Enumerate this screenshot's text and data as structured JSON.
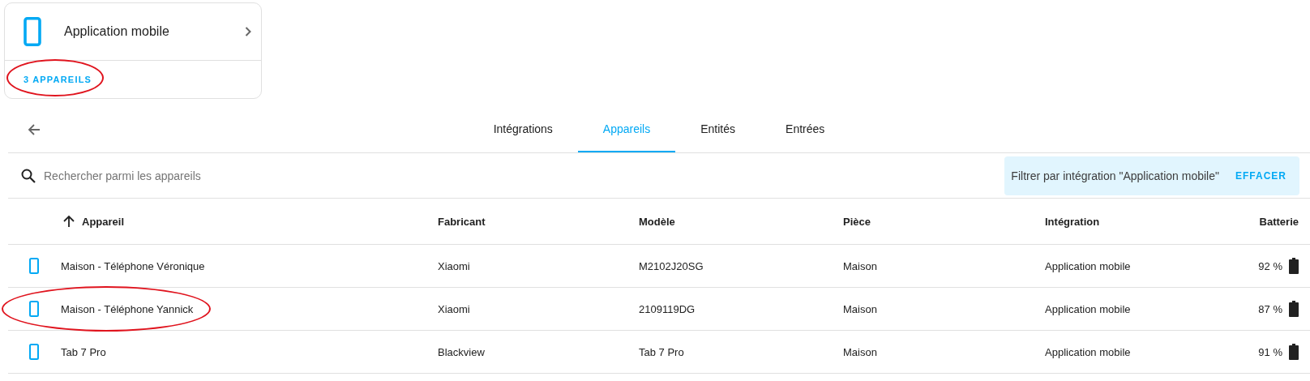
{
  "card": {
    "title": "Application mobile",
    "link": "3 APPAREILS",
    "circled": true
  },
  "tabs": [
    {
      "label": "Intégrations",
      "selected": false
    },
    {
      "label": "Appareils",
      "selected": true
    },
    {
      "label": "Entités",
      "selected": false
    },
    {
      "label": "Entrées",
      "selected": false
    }
  ],
  "search": {
    "placeholder": "Rechercher parmi les appareils"
  },
  "filter": {
    "label": "Filtrer par intégration \"Application mobile\"",
    "action": "EFFACER"
  },
  "table": {
    "columns": [
      {
        "label": "Appareil",
        "sorted": true
      },
      {
        "label": "Fabricant",
        "sorted": false
      },
      {
        "label": "Modèle",
        "sorted": false
      },
      {
        "label": "Pièce",
        "sorted": false
      },
      {
        "label": "Intégration",
        "sorted": false
      },
      {
        "label": "Batterie",
        "sorted": false
      }
    ],
    "rows": [
      {
        "cells": [
          "Maison - Téléphone Véronique",
          "Xiaomi",
          "M2102J20SG",
          "Maison",
          "Application mobile"
        ],
        "battery": "92 %",
        "circled": false
      },
      {
        "cells": [
          "Maison - Téléphone Yannick",
          "Xiaomi",
          "2109119DG",
          "Maison",
          "Application mobile"
        ],
        "battery": "87 %",
        "circled": true
      },
      {
        "cells": [
          "Tab 7 Pro",
          "Blackview",
          "Tab 7 Pro",
          "Maison",
          "Application mobile"
        ],
        "battery": "91 %",
        "circled": false
      }
    ]
  }
}
